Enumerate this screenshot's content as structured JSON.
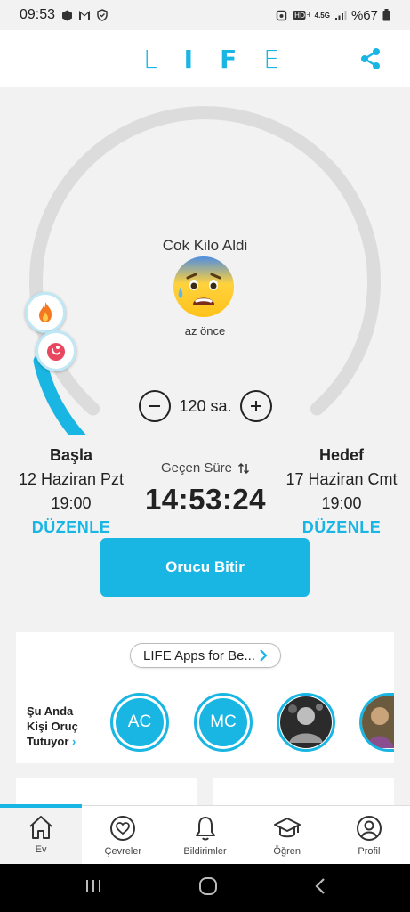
{
  "status_bar": {
    "time": "09:53",
    "battery": "%67",
    "network": "4.5G"
  },
  "header": {
    "logo_letters": [
      "L",
      "I",
      "F",
      "E"
    ],
    "accent": "#19b6e3"
  },
  "dial": {
    "status_text": "Cok Kilo Aldi",
    "emoji": "anxious-face-with-sweat",
    "last_update": "az önce",
    "duration_label": "120 sa.",
    "progress_fraction": 0.12
  },
  "start": {
    "title": "Başla",
    "date": "12 Haziran Pzt",
    "time": "19:00",
    "edit": "DÜZENLE"
  },
  "goal": {
    "title": "Hedef",
    "date": "17 Haziran Cmt",
    "time": "19:00",
    "edit": "DÜZENLE"
  },
  "timer": {
    "label": "Geçen Süre",
    "value": "14:53:24"
  },
  "end_fast_button": "Orucu Bitir",
  "social": {
    "apps_pill": "LIFE Apps for Be...",
    "fasting_now": [
      "Şu Anda",
      "Kişi Oruç",
      "Tutuyor"
    ],
    "avatars": [
      "AC",
      "MC"
    ]
  },
  "tabs": [
    {
      "label": "Ev",
      "icon": "home-icon"
    },
    {
      "label": "Çevreler",
      "icon": "heart-circle-icon"
    },
    {
      "label": "Bildirimler",
      "icon": "bell-icon"
    },
    {
      "label": "Öğren",
      "icon": "graduation-cap-icon"
    },
    {
      "label": "Profil",
      "icon": "profile-icon"
    }
  ]
}
